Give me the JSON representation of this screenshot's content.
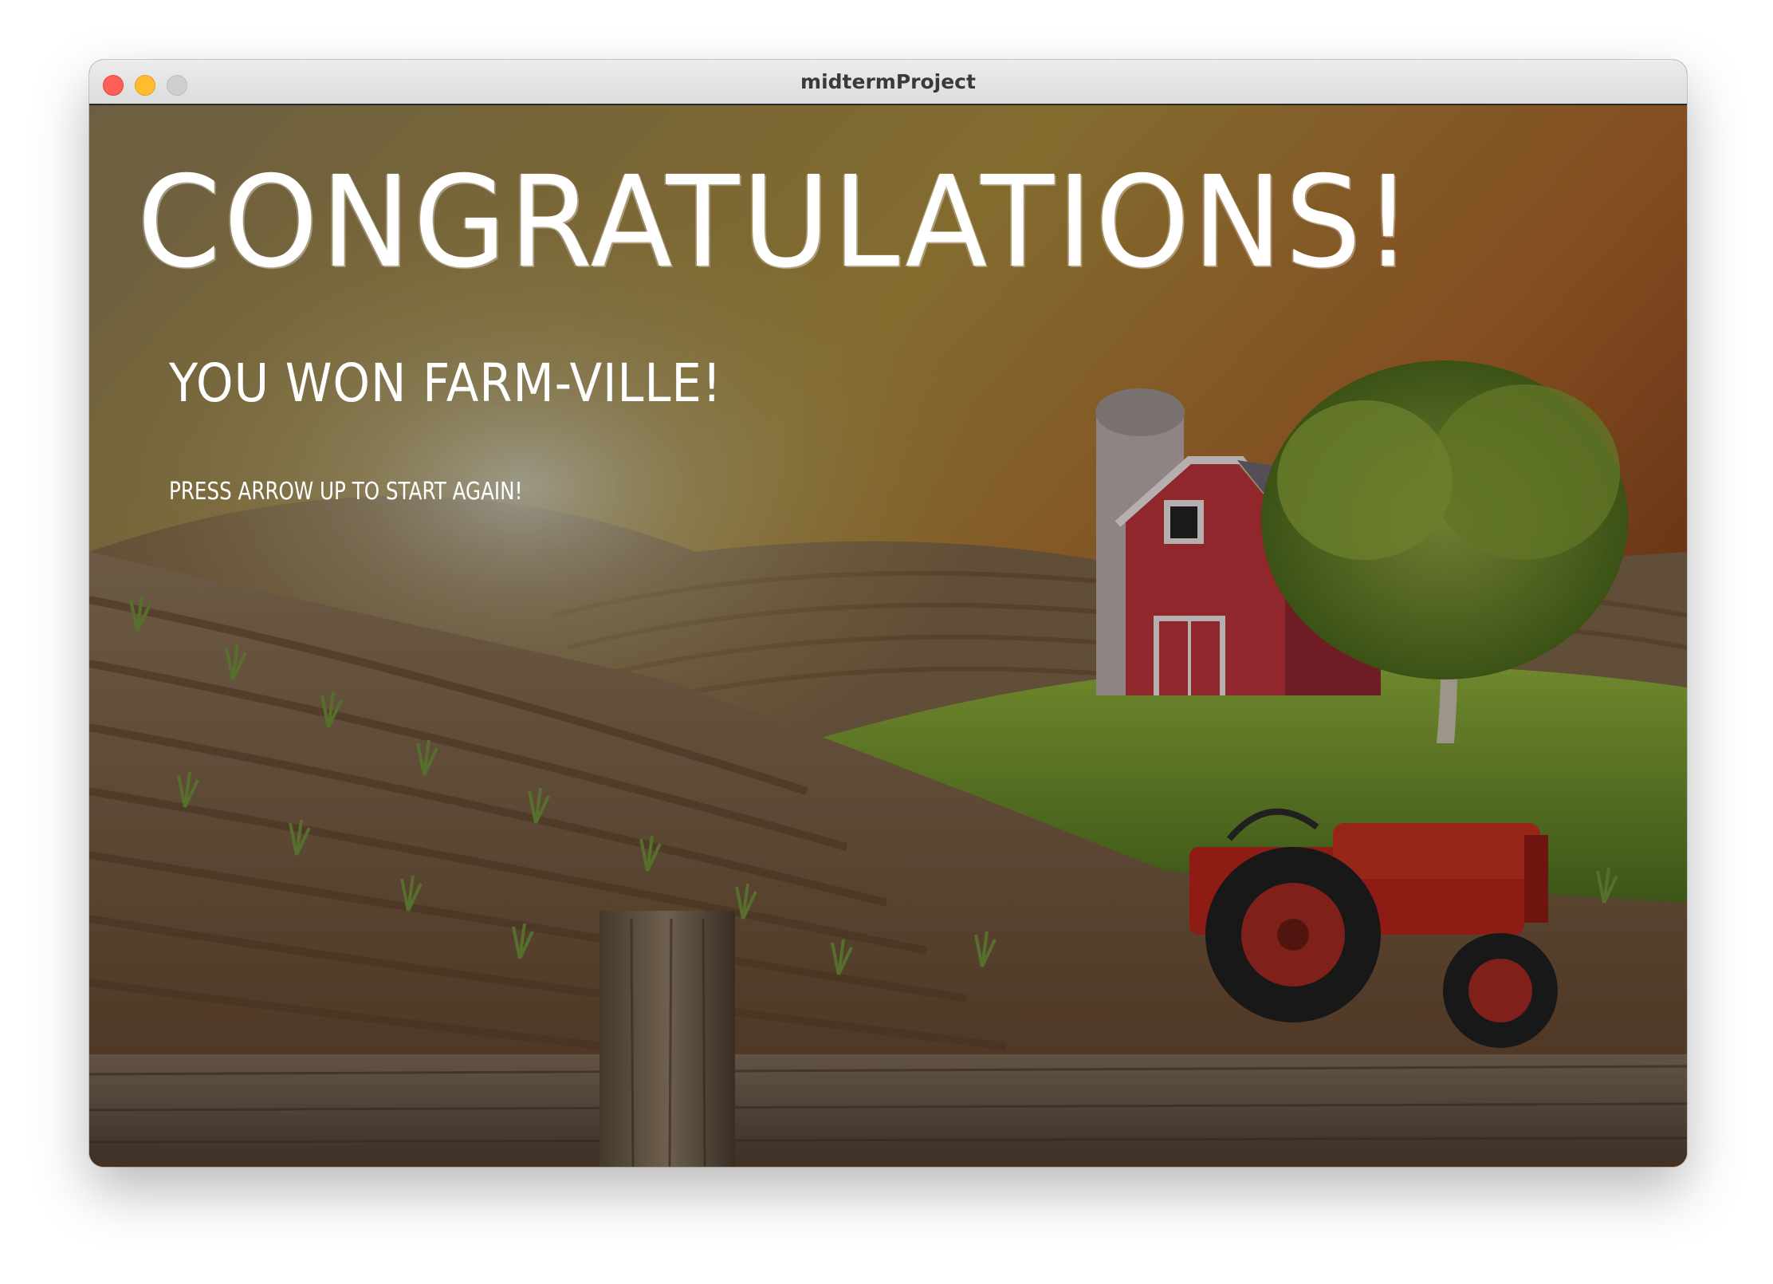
{
  "window": {
    "title": "midtermProject",
    "controls": [
      "close",
      "minimize",
      "maximize"
    ]
  },
  "game": {
    "headline": "CONGRATULATIONS!",
    "subheadline": "YOU WON FARM-VILLE!",
    "instruction": "PRESS ARROW UP TO START AGAIN!"
  },
  "colors": {
    "sky": "#b08a3a",
    "sunset": "#b55a22",
    "soil": "#7a5636",
    "grass": "#6f8f2e",
    "barn": "#b8323a",
    "tractor": "#b7241b",
    "fence": "#6b5a48",
    "text": "#ffffff"
  }
}
